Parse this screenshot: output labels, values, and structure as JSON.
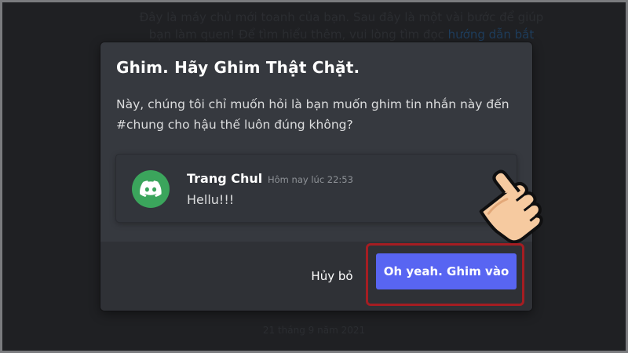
{
  "background": {
    "intro_text": "Đây là máy chủ mới toanh của bạn. Sau đây là một vài bước để giúp bạn làm quen! Để tìm hiểu thêm, vui lòng tìm đọc ",
    "intro_link": "hướng dẫn bắt",
    "date_divider": "21 tháng 9 năm 2021"
  },
  "modal": {
    "title": "Ghim. Hãy Ghim Thật Chặt.",
    "description": "Này, chúng tôi chỉ muốn hỏi là bạn muốn ghim tin nhắn này đến #chung cho hậu thế luôn đúng không?",
    "message": {
      "author": "Trang Chul",
      "timestamp": "Hôm nay lúc 22:53",
      "content": "Hellu!!!",
      "avatar_icon": "discord-logo-icon",
      "avatar_color": "#3ba55c"
    },
    "cancel_label": "Hủy bỏ",
    "confirm_label": "Oh yeah. Ghim vào"
  },
  "colors": {
    "accent": "#5865f2",
    "highlight": "#a51d22"
  }
}
